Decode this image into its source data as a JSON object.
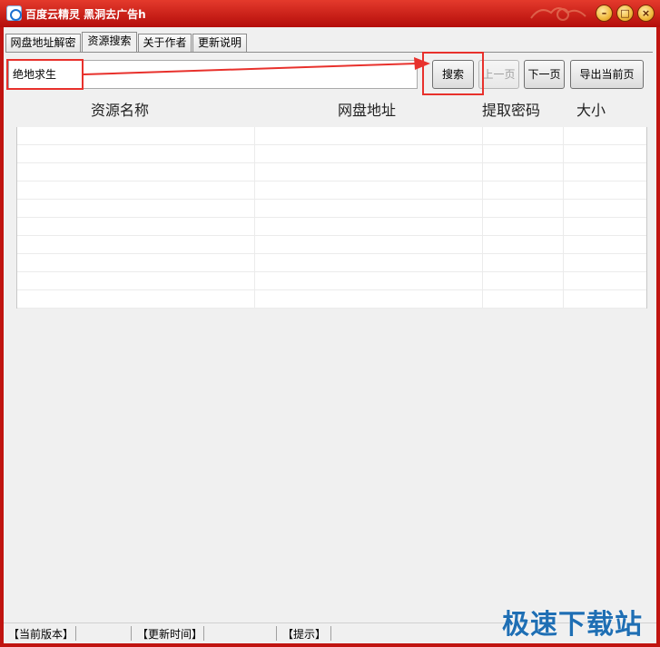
{
  "window": {
    "title": "百度云精灵 黑洞去广告h",
    "min_symbol": "–",
    "max_symbol": "□",
    "close_symbol": "×"
  },
  "tabs": [
    {
      "label": "网盘地址解密",
      "active": false
    },
    {
      "label": "资源搜索",
      "active": true
    },
    {
      "label": "关于作者",
      "active": false
    },
    {
      "label": "更新说明",
      "active": false
    }
  ],
  "search": {
    "value": "绝地求生"
  },
  "buttons": {
    "search": "搜索",
    "prev": "上一页",
    "next": "下一页",
    "export": "导出当前页"
  },
  "table": {
    "columns": [
      "资源名称",
      "网盘地址",
      "提取密码",
      "大小"
    ],
    "rows": []
  },
  "status": {
    "version": "【当前版本】",
    "update_time": "【更新时间】",
    "tip": "【提示】"
  },
  "watermark": "极速下载站",
  "colors": {
    "title_bar": "#c01410",
    "highlight": "#e8312c",
    "watermark": "#1f6fb4"
  }
}
